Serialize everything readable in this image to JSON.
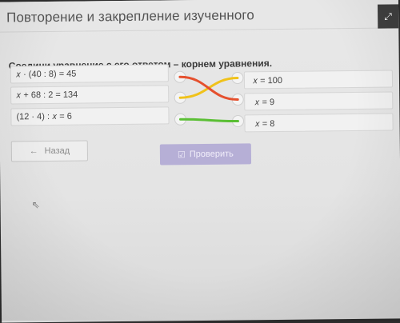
{
  "header": {
    "title": "Повторение и закрепление изученного",
    "corner_icon": "expand-icon",
    "corner_glyph": "⤢"
  },
  "task": {
    "prompt": "Соедини уравнение с его ответом – корнем уравнения."
  },
  "equations": [
    {
      "text": "𝑥 · (40 : 8) = 45"
    },
    {
      "text": "𝑥 + 68 : 2 = 134"
    },
    {
      "text": "(12 · 4) : 𝑥 = 6"
    }
  ],
  "answers": [
    {
      "text": "𝑥 = 100"
    },
    {
      "text": "𝑥 = 9"
    },
    {
      "text": "𝑥 = 8"
    }
  ],
  "connections": [
    {
      "from": 1,
      "to": 0,
      "color": "#f0c21a"
    },
    {
      "from": 0,
      "to": 1,
      "color": "#e5502e"
    },
    {
      "from": 2,
      "to": 2,
      "color": "#5bbf35"
    }
  ],
  "buttons": {
    "back": {
      "label": "Назад",
      "icon": "arrow-left-icon",
      "glyph": "←"
    },
    "check": {
      "label": "Проверить",
      "icon": "checkbox-icon",
      "glyph": "☑"
    }
  },
  "colors": {
    "accent_button": "#b6afd6",
    "line_yellow": "#f0c21a",
    "line_red": "#e5502e",
    "line_green": "#5bbf35"
  }
}
